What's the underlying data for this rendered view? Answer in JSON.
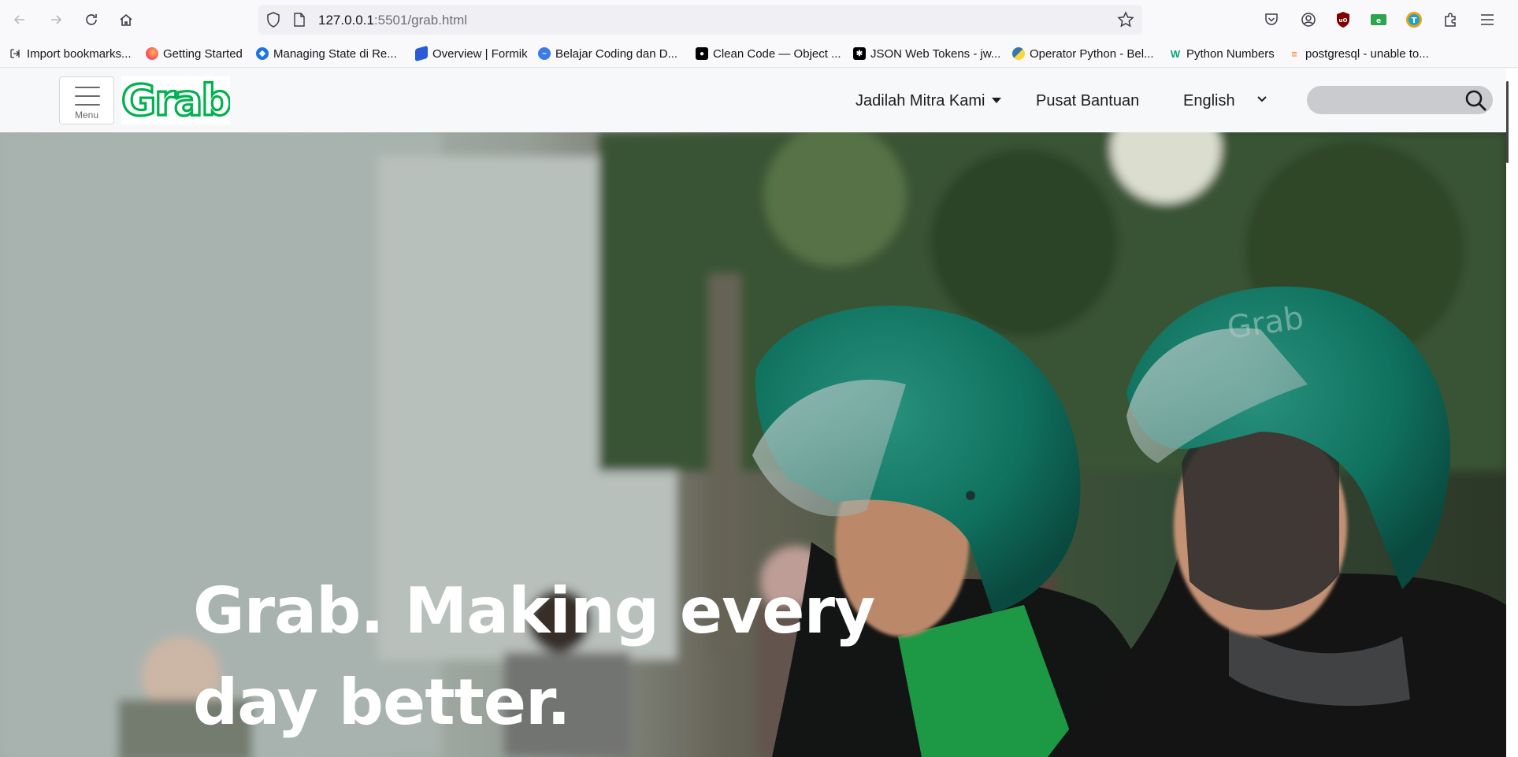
{
  "browser": {
    "url_host": "127.0.0.1",
    "url_path": ":5501/grab.html",
    "bookmarks": [
      {
        "label": "Import bookmarks...",
        "icon": "import-icon"
      },
      {
        "label": "Getting Started",
        "icon": "firefox-icon"
      },
      {
        "label": "Managing State di Re...",
        "icon": "blue-diamond-icon"
      },
      {
        "label": "Overview | Formik",
        "icon": "formik-icon"
      },
      {
        "label": "Belajar Coding dan D...",
        "icon": "blue-wave-icon"
      },
      {
        "label": "Clean Code — Object ...",
        "icon": "medium-icon"
      },
      {
        "label": "JSON Web Tokens - jw...",
        "icon": "jwt-icon"
      },
      {
        "label": "Operator Python - Bel...",
        "icon": "python-icon"
      },
      {
        "label": "Python Numbers",
        "icon": "w3schools-icon"
      },
      {
        "label": "postgresql - unable to...",
        "icon": "stackoverflow-icon"
      }
    ]
  },
  "header": {
    "menu_label": "Menu",
    "logo_text": "Grab",
    "nav": [
      {
        "label": "Jadilah Mitra Kami",
        "has_dropdown": true
      },
      {
        "label": "Pusat Bantuan",
        "has_dropdown": false
      }
    ],
    "language": {
      "selected": "English"
    },
    "search": {
      "placeholder": ""
    }
  },
  "hero": {
    "headline": "Grab. Making every day better."
  },
  "colors": {
    "brand_green": "#00b14f",
    "header_bg": "#f7f8fa",
    "search_bg": "#c9cbcf"
  }
}
